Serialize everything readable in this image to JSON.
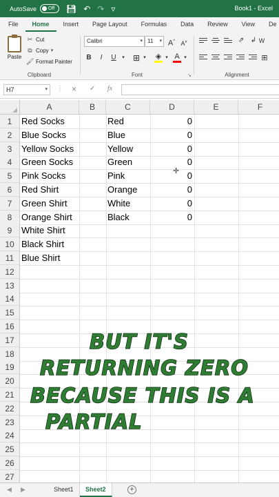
{
  "titlebar": {
    "autosave_label": "AutoSave",
    "autosave_state": "Off",
    "doc_title": "Book1 - Excel"
  },
  "ribbon_tabs": [
    "File",
    "Home",
    "Insert",
    "Page Layout",
    "Formulas",
    "Data",
    "Review",
    "View",
    "De"
  ],
  "active_tab": "Home",
  "ribbon": {
    "paste": "Paste",
    "cut": "Cut",
    "copy": "Copy",
    "format_painter": "Format Painter",
    "clipboard_label": "Clipboard",
    "font_name": "Calibri",
    "font_size": "11",
    "bold": "B",
    "italic": "I",
    "underline": "U",
    "font_label": "Font",
    "alignment_label": "Alignment",
    "wrap_partial": "W",
    "fill_color": "#ffff00",
    "font_color": "#ff0000"
  },
  "formula_bar": {
    "name_box": "H7",
    "fx": "fx",
    "cancel": "×",
    "enter": "✓",
    "formula": ""
  },
  "columns": [
    "A",
    "B",
    "C",
    "D",
    "E",
    "F"
  ],
  "row_numbers": [
    "1",
    "2",
    "3",
    "4",
    "5",
    "6",
    "7",
    "8",
    "9",
    "10",
    "11",
    "12",
    "13",
    "14",
    "15",
    "16",
    "17",
    "18",
    "19",
    "20",
    "21",
    "22",
    "23",
    "24",
    "25",
    "26",
    "27"
  ],
  "cells": {
    "A": [
      "Red Socks",
      "Blue Socks",
      "Yellow Socks",
      "Green Socks",
      "Pink Socks",
      "Red Shirt",
      "Green Shirt",
      "Orange Shirt",
      "White Shirt",
      "Black Shirt",
      "Blue Shirt"
    ],
    "C": [
      "Red",
      "Blue",
      "Yellow",
      "Green",
      "Pink",
      "Orange",
      "White",
      "Black"
    ],
    "D": [
      "0",
      "0",
      "0",
      "0",
      "0",
      "0",
      "0",
      "0"
    ]
  },
  "sheet_tabs": [
    "Sheet1",
    "Sheet2"
  ],
  "active_sheet": "Sheet2",
  "caption_lines": [
    "BUT IT'S",
    "RETURNING ZERO",
    "BECAUSE THIS IS A",
    "PARTIAL"
  ],
  "colors": {
    "excel_green": "#217346",
    "caption_fill": "#2e7d32",
    "caption_outline": "#0c2b10"
  }
}
